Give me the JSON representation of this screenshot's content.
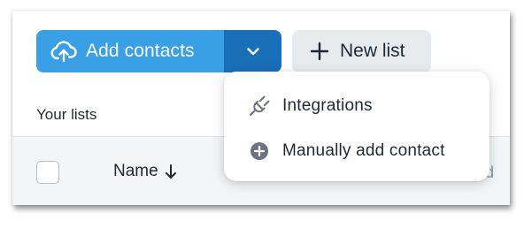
{
  "toolbar": {
    "add_contacts_label": "Add contacts",
    "new_list_label": "New list",
    "icons": {
      "add_contacts": "cloud-upload-icon",
      "toggle": "chevron-down-icon",
      "new_list": "plus-icon"
    }
  },
  "lists": {
    "section_title": "Your lists",
    "columns": {
      "name": "Name",
      "partial": "ed"
    }
  },
  "dropdown_menu": {
    "items": [
      {
        "label": "Integrations",
        "icon": "plug-icon"
      },
      {
        "label": "Manually add contact",
        "icon": "plus-circle-icon"
      }
    ]
  },
  "colors": {
    "primary": "#3aa0e6",
    "primary_dark": "#1a6fb9",
    "secondary_bg": "#e8ebee",
    "header_bg": "#f3f5f7",
    "text": "#1f2933",
    "icon_gray": "#6b7280"
  }
}
